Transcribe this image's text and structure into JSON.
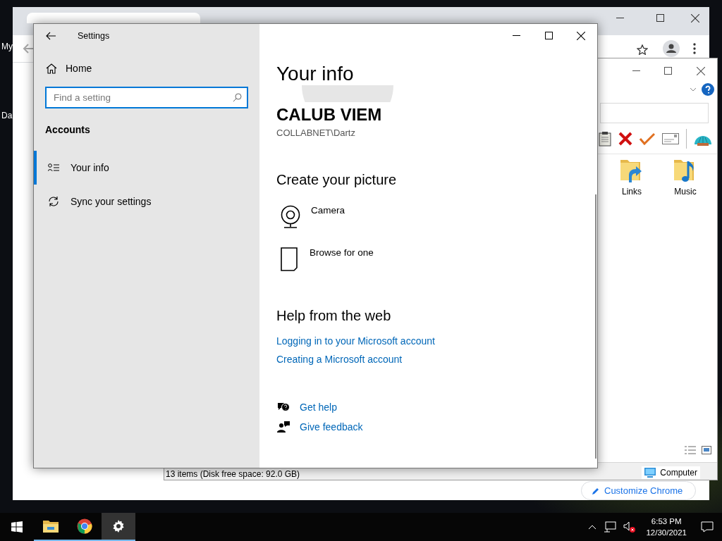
{
  "desktop": {
    "icons": [
      {
        "label": "My"
      },
      {
        "label": "Da"
      }
    ]
  },
  "browser": {
    "customize_button": "Customize Chrome"
  },
  "explorer": {
    "folders": [
      {
        "kind": "links",
        "name": "Links"
      },
      {
        "kind": "music",
        "name": "Music"
      }
    ],
    "status_text": "13 items (Disk free space: 92.0 GB)",
    "location": "Computer"
  },
  "settings": {
    "title": "Settings",
    "home": "Home",
    "search": {
      "placeholder": "Find a setting"
    },
    "section": "Accounts",
    "items": [
      {
        "kind": "info",
        "label": "Your info",
        "selected": true
      },
      {
        "kind": "sync",
        "label": "Sync your settings",
        "selected": false
      }
    ],
    "page_title": "Your info",
    "user_name": "CALUB VIEM",
    "account": "COLLABNET\\Dartz",
    "picture_heading": "Create your picture",
    "picture_options": [
      {
        "kind": "camera",
        "label": "Camera"
      },
      {
        "kind": "browse",
        "label": "Browse for one"
      }
    ],
    "help_heading": "Help from the web",
    "links": [
      "Logging in to your Microsoft account",
      "Creating a Microsoft account"
    ],
    "actions": [
      {
        "kind": "help",
        "label": "Get help"
      },
      {
        "kind": "feedback",
        "label": "Give feedback"
      }
    ]
  },
  "taskbar": {
    "apps": [
      {
        "kind": "explorer",
        "selected": false
      },
      {
        "kind": "chrome",
        "selected": false
      },
      {
        "kind": "settings",
        "selected": true
      }
    ],
    "time": "6:53 PM",
    "date": "12/30/2021"
  }
}
